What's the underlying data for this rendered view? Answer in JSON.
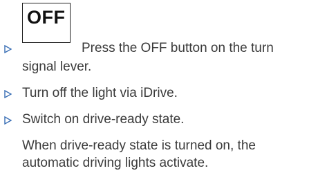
{
  "instructions": {
    "off_button_label": "OFF",
    "step1_line1": "Press the OFF button on the turn",
    "step1_line2": "signal lever.",
    "step2": "Turn off the light via iDrive.",
    "step3": "Switch on drive-ready state.",
    "note_line1": "When drive-ready state is turned on, the",
    "note_line2": "automatic driving lights activate."
  },
  "bullet_color": "#3a6fb5",
  "text_color": "#3a3a3a"
}
